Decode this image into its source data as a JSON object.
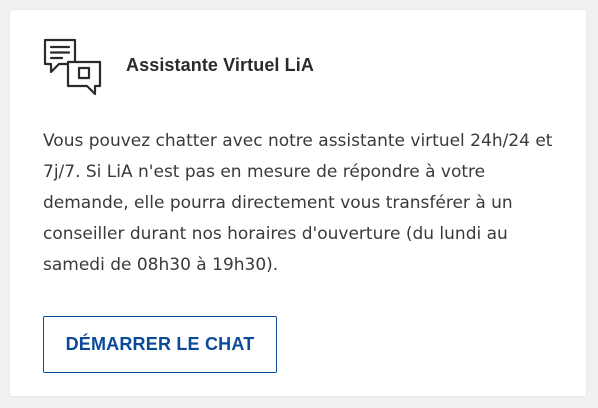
{
  "card": {
    "title": "Assistante Virtuel LiA",
    "icon": "chat-bubbles-icon",
    "description": "Vous pouvez chatter avec notre assistante virtuel 24h/24 et 7j/7. Si LiA n'est pas en mesure de répondre à votre demande, elle pourra directement vous transférer à un conseiller durant nos horaires d'ouverture (du lundi au samedi de 08h30 à 19h30).",
    "button_label": "DÉMARRER LE CHAT"
  },
  "colors": {
    "accent": "#0a4a99",
    "text": "#3a3a3a",
    "background": "#f1f1f1",
    "card": "#ffffff"
  }
}
